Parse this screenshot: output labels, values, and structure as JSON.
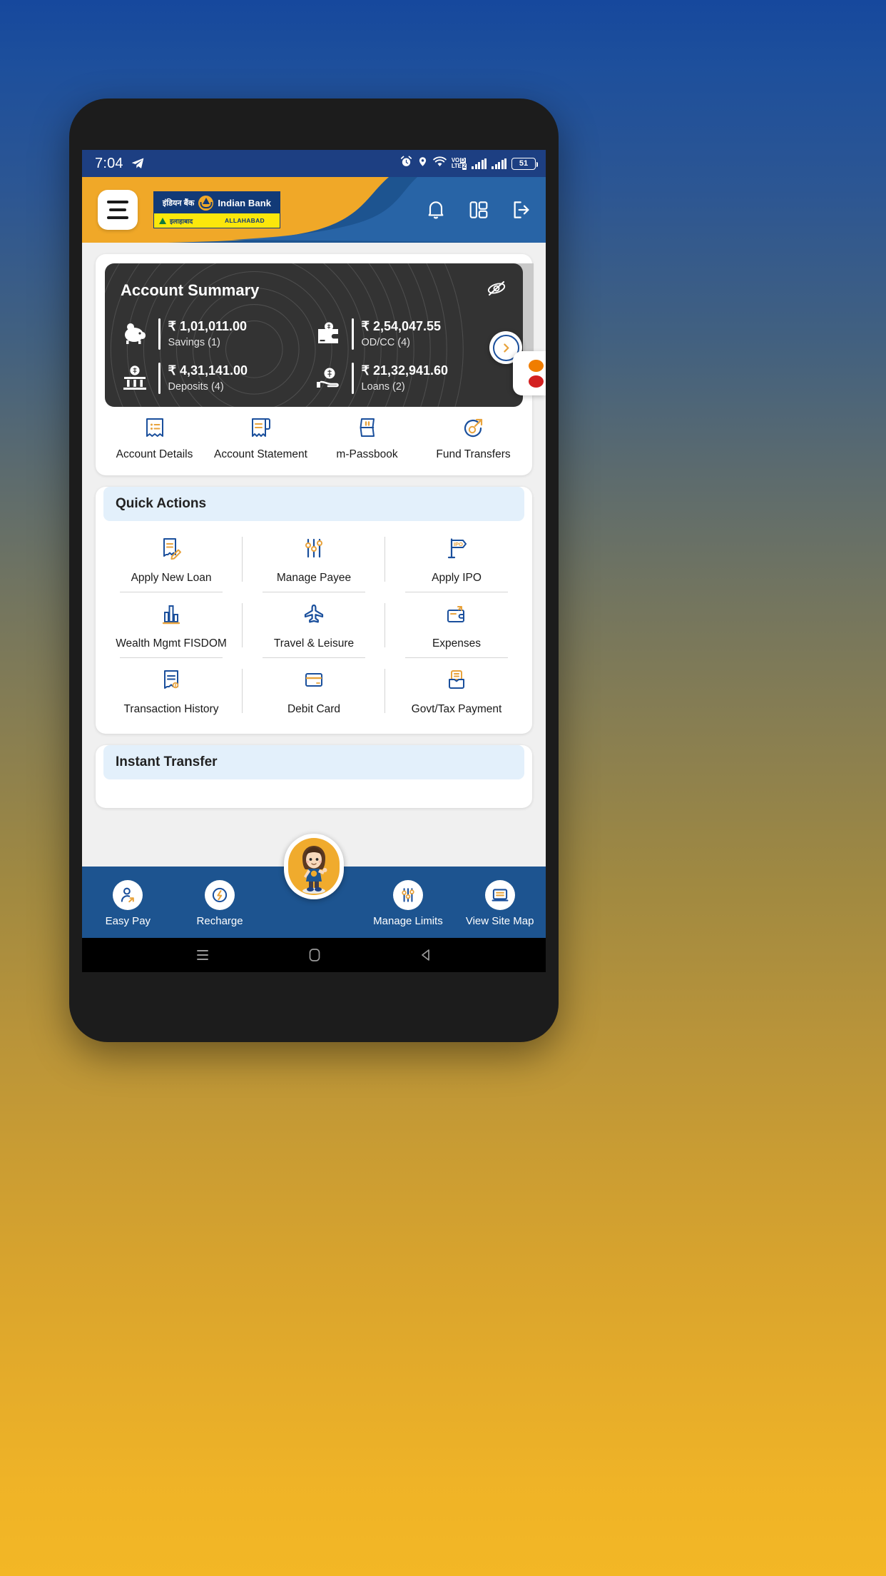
{
  "status_bar": {
    "time": "7:04",
    "left_icons": [
      "telegram-icon"
    ],
    "right_icons": [
      "alarm-icon",
      "location-icon",
      "wifi-icon"
    ],
    "network_label_line1": "VO",
    "network_label_line2": "LTE",
    "network_badge_1": "D",
    "network_badge_2": "2",
    "battery_level": "51",
    "background_color": "#1d3f82"
  },
  "header": {
    "menu_label": "menu",
    "logo": {
      "name_hi": "इंडियन बैंक",
      "name_en": "Indian Bank",
      "sub_hi": "इलाहाबाद",
      "sub_en": "ALLAHABAD"
    },
    "actions": [
      {
        "name": "notifications",
        "icon": "bell-icon"
      },
      {
        "name": "dashboard",
        "icon": "dashboard-grid-icon"
      },
      {
        "name": "logout",
        "icon": "logout-icon"
      }
    ],
    "accent_color": "#f0a828",
    "wave_color": "#1d5490"
  },
  "account_summary": {
    "title": "Account Summary",
    "hide_balance_icon": "eye-off-icon",
    "next_icon": "chevron-right-icon",
    "items": [
      {
        "amount": "₹ 1,01,011.00",
        "label": "Savings (1)",
        "icon": "piggy-bank-icon"
      },
      {
        "amount": "₹ 2,54,047.55",
        "label": "OD/CC (4)",
        "icon": "wallet-icon"
      },
      {
        "amount": "₹ 4,31,141.00",
        "label": "Deposits (4)",
        "icon": "bank-deposit-icon"
      },
      {
        "amount": "₹ 21,32,941.60",
        "label": "Loans (2)",
        "icon": "loan-hand-icon"
      }
    ]
  },
  "quick_access": [
    {
      "label": "Account Details",
      "icon": "account-details-icon"
    },
    {
      "label": "Account Statement",
      "icon": "account-statement-icon"
    },
    {
      "label": "m-Passbook",
      "icon": "passbook-icon"
    },
    {
      "label": "Fund Transfers",
      "icon": "fund-transfer-icon"
    }
  ],
  "quick_actions": {
    "title": "Quick Actions",
    "items": [
      {
        "label": "Apply New Loan",
        "icon": "apply-loan-icon"
      },
      {
        "label": "Manage Payee",
        "icon": "sliders-icon"
      },
      {
        "label": "Apply IPO",
        "icon": "ipo-flag-icon"
      },
      {
        "label": "Wealth Mgmt FISDOM",
        "icon": "bar-chart-icon"
      },
      {
        "label": "Travel & Leisure",
        "icon": "airplane-icon"
      },
      {
        "label": "Expenses",
        "icon": "expenses-wallet-icon"
      },
      {
        "label": "Transaction History",
        "icon": "transaction-history-icon"
      },
      {
        "label": "Debit Card",
        "icon": "debit-card-icon"
      },
      {
        "label": "Govt/Tax Payment",
        "icon": "govt-tax-icon"
      }
    ]
  },
  "instant_transfer": {
    "title": "Instant Transfer"
  },
  "bottom_nav": {
    "items": [
      {
        "label": "Easy Pay",
        "icon": "easy-pay-icon"
      },
      {
        "label": "Recharge",
        "icon": "recharge-icon"
      },
      {
        "label": "Manage Limits",
        "icon": "manage-limits-icon"
      },
      {
        "label": "View Site Map",
        "icon": "site-map-icon"
      }
    ],
    "assistant_icon": "assistant-avatar",
    "background_color": "#1d5490"
  },
  "android_nav": {
    "recents_icon": "recents-icon",
    "home_icon": "home-icon",
    "back_icon": "back-icon"
  },
  "side_widget": {
    "dot_1_color": "#f07d00",
    "dot_2_color": "#d32020"
  }
}
